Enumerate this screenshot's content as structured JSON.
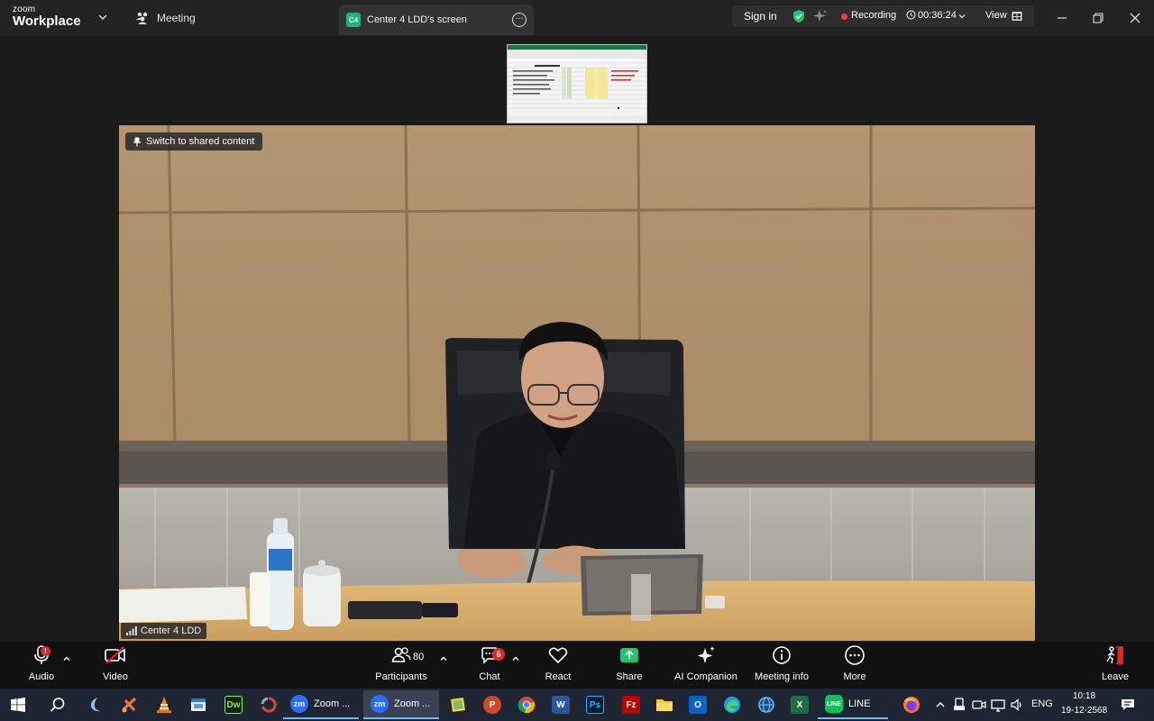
{
  "titlebar": {
    "brand_small": "zoom",
    "brand_big": "Workplace",
    "meeting_label": "Meeting",
    "share_badge": "C4",
    "share_label": "Center 4 LDD's screen",
    "signin": "Sign in",
    "recording": "Recording",
    "timer": "00:36:24",
    "view": "View"
  },
  "video": {
    "switch_label": "Switch to shared content",
    "participant_name": "Center 4 LDD"
  },
  "toolbar": {
    "audio": "Audio",
    "video": "Video",
    "participants": "Participants",
    "participants_count": "80",
    "chat": "Chat",
    "chat_badge": "6",
    "react": "React",
    "share": "Share",
    "ai": "AI Companion",
    "info": "Meeting info",
    "more": "More",
    "leave": "Leave"
  },
  "taskbar": {
    "zoom1": "Zoom ...",
    "zoom2": "Zoom ...",
    "line": "LINE",
    "lang": "ENG",
    "time": "10:18",
    "date": "19-12-2568"
  },
  "colors": {
    "accent_green": "#1eb57a",
    "recording_red": "#ff3b30",
    "share_green": "#1ec86a",
    "leave_red": "#e02828"
  }
}
